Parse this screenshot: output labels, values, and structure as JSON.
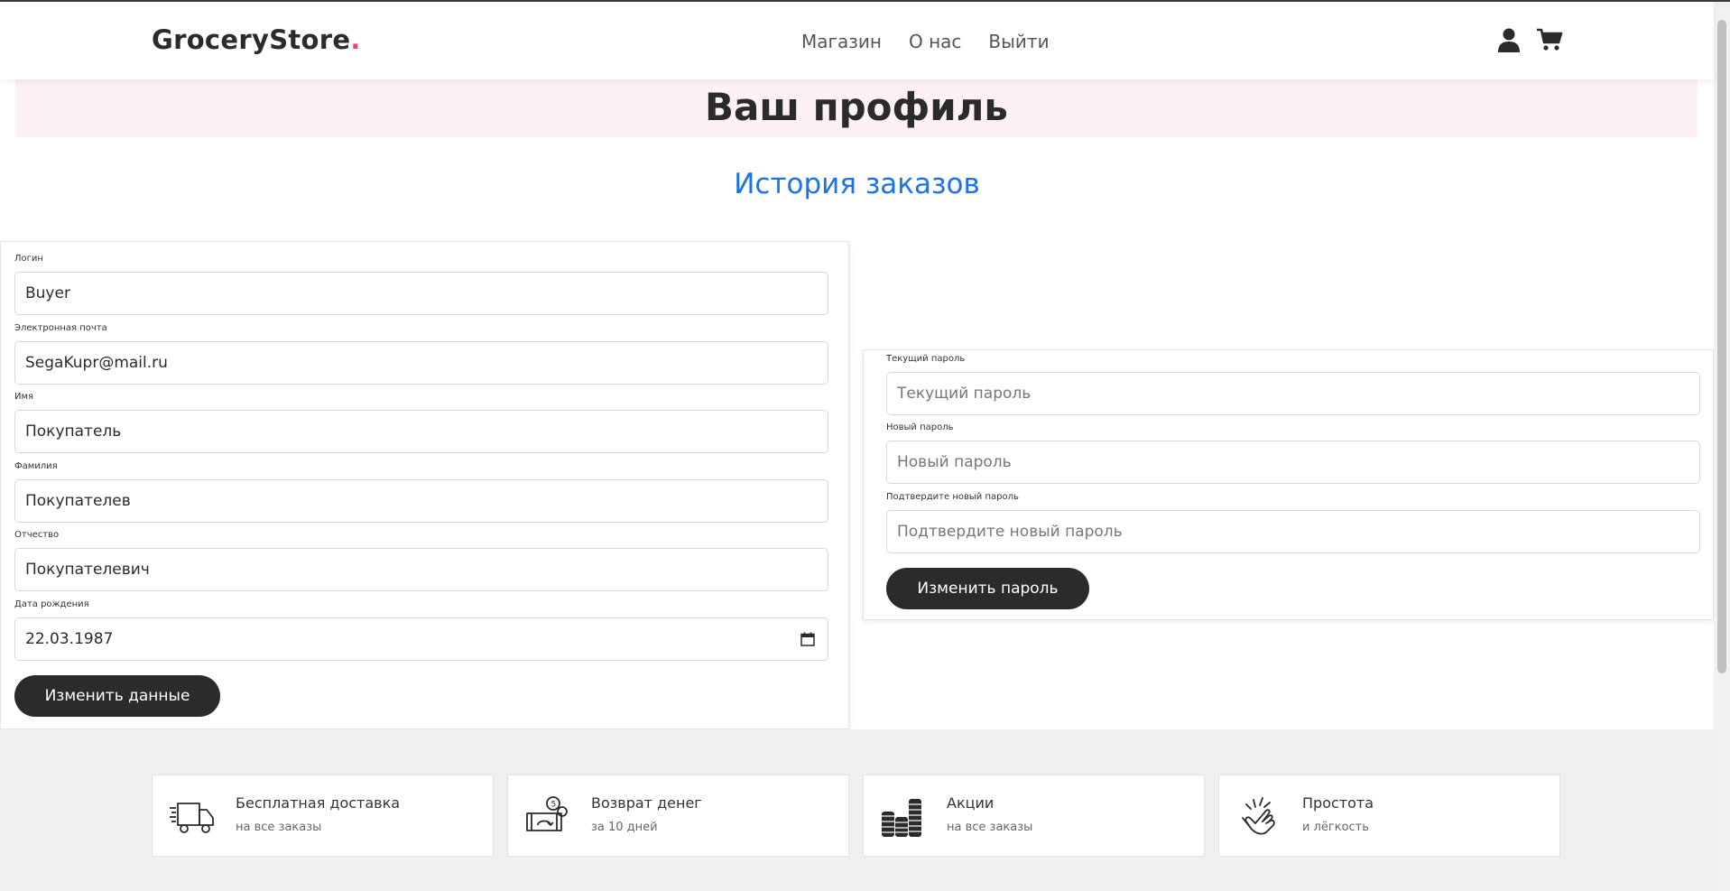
{
  "header": {
    "brand": "GroceryStore",
    "brand_dot": ".",
    "nav": [
      "Магазин",
      "О нас",
      "Выйти"
    ],
    "icons": [
      "user-icon",
      "cart-icon"
    ]
  },
  "profile": {
    "title": "Ваш профиль",
    "history_link": "История заказов"
  },
  "profile_form": {
    "fields": [
      {
        "label": "Логин",
        "value": "Buyer"
      },
      {
        "label": "Электронная почта",
        "value": "SegaKupr@mail.ru"
      },
      {
        "label": "Имя",
        "value": "Покупатель"
      },
      {
        "label": "Фамилия",
        "value": "Покупателев"
      },
      {
        "label": "Отчество",
        "value": "Покупателевич"
      },
      {
        "label": "Дата рождения",
        "value": "22.03.1987"
      }
    ],
    "submit": "Изменить данные"
  },
  "password_form": {
    "fields": [
      {
        "label": "Текущий пароль",
        "placeholder": "Текущий пароль"
      },
      {
        "label": "Новый пароль",
        "placeholder": "Новый пароль"
      },
      {
        "label": "Подтвердите новый пароль",
        "placeholder": "Подтвердите новый пароль"
      }
    ],
    "submit": "Изменить пароль"
  },
  "features": [
    {
      "icon": "delivery-truck-icon",
      "title": "Бесплатная доставка",
      "subtitle": "на все заказы"
    },
    {
      "icon": "money-return-icon",
      "title": "Возврат денег",
      "subtitle": "за 10 дней"
    },
    {
      "icon": "coins-stack-icon",
      "title": "Акции",
      "subtitle": "на все заказы"
    },
    {
      "icon": "hand-snap-icon",
      "title": "Простота",
      "subtitle": "и лёгкость"
    }
  ],
  "colors": {
    "accent_pink": "#e83e8c",
    "link_blue": "#1a73e8",
    "dark_button": "#2b2b2b",
    "band_pink": "#fdf0f7"
  }
}
